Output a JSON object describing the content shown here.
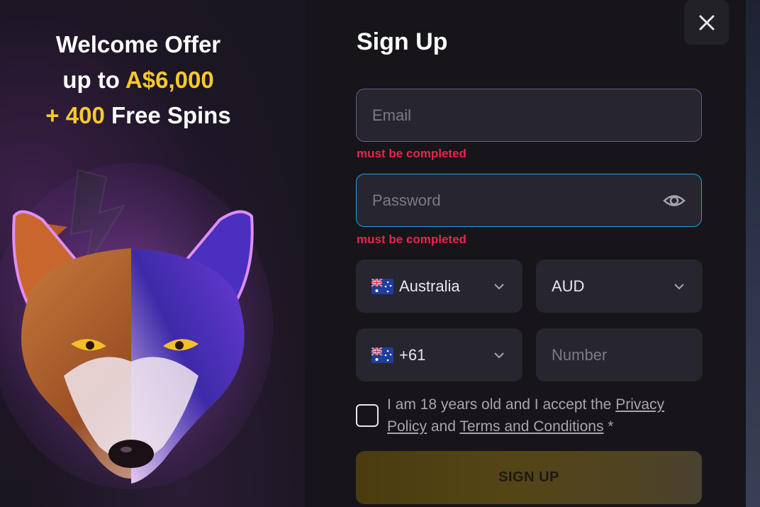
{
  "promo": {
    "line1": "Welcome Offer",
    "line2_prefix": "up to ",
    "line2_amount": "A$6,000",
    "line3_amount": "+ 400",
    "line3_suffix": " Free Spins"
  },
  "form": {
    "title": "Sign Up",
    "email_placeholder": "Email",
    "email_error": "must be completed",
    "password_placeholder": "Password",
    "password_error": "must be completed",
    "country_value": "Australia",
    "currency_value": "AUD",
    "phone_code": "+61",
    "number_placeholder": "Number",
    "agree_text_1": "I am 18 years old and I accept the ",
    "privacy_link": "Privacy Policy",
    "agree_and": " and ",
    "terms_link": "Terms and Conditions",
    "agree_required": " *",
    "signup_button": "SIGN UP"
  },
  "icons": {
    "close": "close-icon",
    "eye": "eye-icon",
    "chevron": "chevron-down-icon",
    "flag": "australia-flag-icon"
  },
  "colors": {
    "accent_yellow": "#f7c92c",
    "error_red": "#e8254d",
    "focus_blue": "#1ea4e0"
  }
}
